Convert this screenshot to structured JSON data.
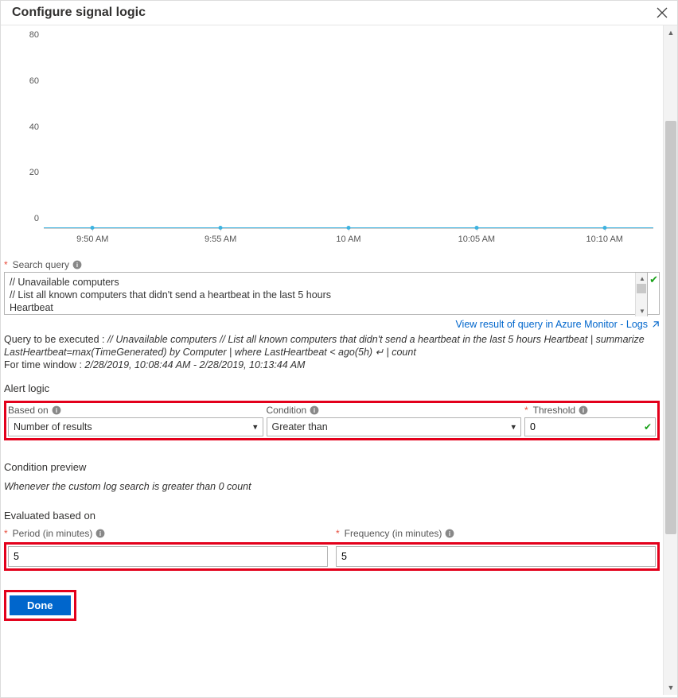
{
  "header": {
    "title": "Configure signal logic"
  },
  "chart_data": {
    "type": "line",
    "categories": [
      "9:50 AM",
      "9:55 AM",
      "10 AM",
      "10:05 AM",
      "10:10 AM"
    ],
    "values": [
      0,
      0,
      0,
      0,
      0
    ],
    "title": "",
    "xlabel": "",
    "ylabel": "",
    "ylim": [
      0,
      80
    ],
    "yticks": [
      0,
      20,
      40,
      60,
      80
    ]
  },
  "search_query": {
    "label": "Search query",
    "text": "// Unavailable computers\n// List all known computers that didn't send a heartbeat in the last 5 hours\nHeartbeat"
  },
  "link": {
    "text": "View result of query in Azure Monitor - Logs"
  },
  "exec": {
    "prefix": "Query to be executed : ",
    "query_text": "// Unavailable computers // List all known computers that didn't send a heartbeat in the last 5 hours Heartbeat | summarize LastHeartbeat=max(TimeGenerated) by Computer | where LastHeartbeat < ago(5h) ↵ | count",
    "time_prefix": "For time window : ",
    "time_window": "2/28/2019, 10:08:44 AM - 2/28/2019, 10:13:44 AM"
  },
  "alert_logic": {
    "heading": "Alert logic",
    "based_on_label": "Based on",
    "based_on_value": "Number of results",
    "condition_label": "Condition",
    "condition_value": "Greater than",
    "threshold_label": "Threshold",
    "threshold_value": "0"
  },
  "preview": {
    "title": "Condition preview",
    "text": "Whenever the custom log search is greater than 0 count"
  },
  "evaluated": {
    "heading": "Evaluated based on",
    "period_label": "Period (in minutes)",
    "period_value": "5",
    "frequency_label": "Frequency (in minutes)",
    "frequency_value": "5"
  },
  "buttons": {
    "done": "Done"
  }
}
